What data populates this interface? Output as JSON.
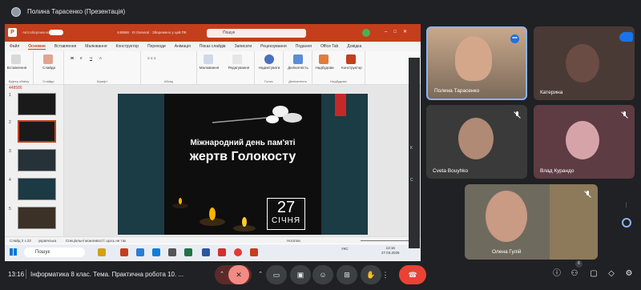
{
  "presenter": {
    "title": "Полина Тарасенко (Презентація)"
  },
  "powerpoint": {
    "autosave": "Автозбереження",
    "doc_name": "448586 · ІІІ General · Збережено у цей ПК",
    "search": "Пошук",
    "tabs": [
      "Файл",
      "Основне",
      "Вставлення",
      "Малювання",
      "Конструктор",
      "Переходи",
      "Анімація",
      "Показ слайдів",
      "Записати",
      "Рецензування",
      "Подання",
      "Office Tab",
      "Довідка"
    ],
    "active_tab": 1,
    "groups": {
      "clipboard": "Буфер обміну",
      "slides": "Слайди",
      "font": "Шрифт",
      "paragraph": "Абзац",
      "voice": "Голос",
      "sensitivity": "Делікатність",
      "addins": "Надбудови"
    },
    "buttons": {
      "paste": "Вставлення",
      "slides": "Слайди",
      "draw": "Малювання",
      "edit": "Редагування",
      "dictate": "Надиктувати",
      "sensitivity": "Делікатність",
      "addins": "Надбудови",
      "designer": "Конструктор"
    },
    "thumb_label": "448586",
    "thumb_numbers": [
      "1",
      "2",
      "3",
      "4",
      "5"
    ],
    "status": {
      "slide": "Слайд 2 з 22",
      "lang": "українська",
      "access": "Спеціальні можливості: щось не так",
      "notes": "Нотатки"
    },
    "slide": {
      "line1": "Міжнародний день пам'яті",
      "line2": "жертв Голокосту",
      "day": "27",
      "month": "СІЧНЯ"
    }
  },
  "taskbar": {
    "search": "Пошук",
    "clock_time": "13:16",
    "clock_date": "27.03.2025",
    "lang": "УКС"
  },
  "participants": [
    {
      "name": "Полина Тарасенко"
    },
    {
      "name": "Катерина"
    },
    {
      "name": "Cveta Bouyhko"
    },
    {
      "name": "Влад Курандо"
    },
    {
      "name": "Олена Гулій"
    }
  ],
  "strip_letters": [
    "К",
    "С"
  ],
  "meeting": {
    "time": "13:16",
    "title": "Інформатика 8 клас. Тема. Практична робота 10. ...",
    "people_count": "6"
  },
  "colors": {
    "ppt": "#c43e1c",
    "end_call": "#ea4335",
    "accent": "#1a73e8"
  }
}
